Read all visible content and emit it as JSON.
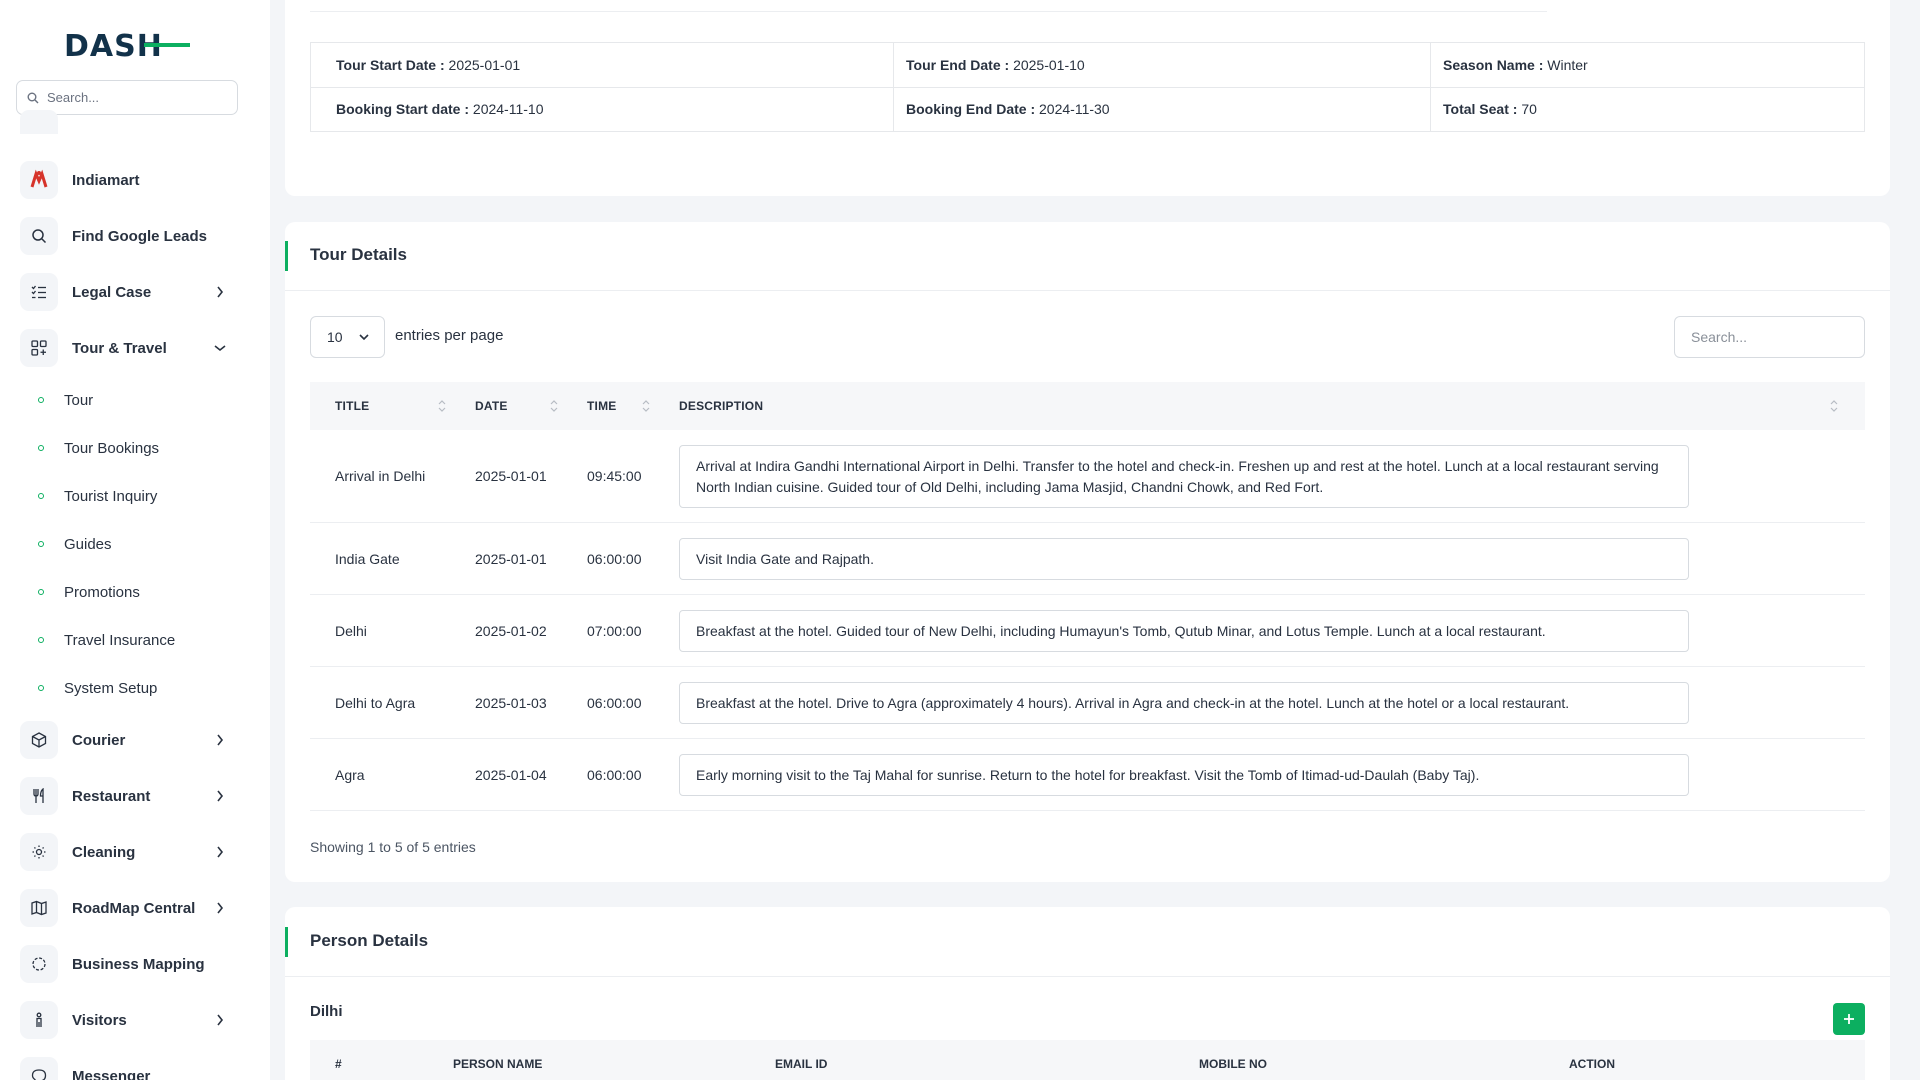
{
  "brand": {
    "logo_text": "DASH",
    "accent_color": "#0caf60"
  },
  "sidebar": {
    "search_placeholder": "Search...",
    "items": [
      {
        "label": "Indiamart",
        "icon": "indiamart-logo-icon",
        "has_chevron": false
      },
      {
        "label": "Find Google Leads",
        "icon": "search-icon",
        "has_chevron": false
      },
      {
        "label": "Legal Case",
        "icon": "list-check-icon",
        "has_chevron": true
      },
      {
        "label": "Tour & Travel",
        "icon": "grid-plus-icon",
        "has_chevron": true,
        "expanded": true
      },
      {
        "label": "Courier",
        "icon": "package-icon",
        "has_chevron": true
      },
      {
        "label": "Restaurant",
        "icon": "fork-knife-icon",
        "has_chevron": true
      },
      {
        "label": "Cleaning",
        "icon": "sun-icon",
        "has_chevron": true
      },
      {
        "label": "RoadMap Central",
        "icon": "map-icon",
        "has_chevron": true
      },
      {
        "label": "Business Mapping",
        "icon": "circle-dashed-icon",
        "has_chevron": false
      },
      {
        "label": "Visitors",
        "icon": "person-icon",
        "has_chevron": true
      },
      {
        "label": "Messenger",
        "icon": "chat-icon",
        "has_chevron": false
      }
    ],
    "sub_items": [
      "Tour",
      "Tour Bookings",
      "Tourist Inquiry",
      "Guides",
      "Promotions",
      "Travel Insurance",
      "System Setup"
    ]
  },
  "tour_info": {
    "tour_start_label": "Tour Start Date :",
    "tour_start_value": "2025-01-01",
    "tour_end_label": "Tour End Date :",
    "tour_end_value": "2025-01-10",
    "season_label": "Season Name :",
    "season_value": "Winter",
    "booking_start_label": "Booking Start date :",
    "booking_start_value": "2024-11-10",
    "booking_end_label": "Booking End Date :",
    "booking_end_value": "2024-11-30",
    "total_seat_label": "Total Seat :",
    "total_seat_value": "70"
  },
  "tour_details": {
    "title": "Tour Details",
    "entries_value": "10",
    "entries_label": "entries per page",
    "search_placeholder": "Search...",
    "columns": [
      "TITLE",
      "DATE",
      "TIME",
      "DESCRIPTION"
    ],
    "rows": [
      {
        "title": "Arrival in Delhi",
        "date": "2025-01-01",
        "time": "09:45:00",
        "description": "Arrival at Indira Gandhi International Airport in Delhi. Transfer to the hotel and check-in. Freshen up and rest at the hotel. Lunch at a local restaurant serving North Indian cuisine. Guided tour of Old Delhi, including Jama Masjid, Chandni Chowk, and Red Fort."
      },
      {
        "title": "India Gate",
        "date": "2025-01-01",
        "time": "06:00:00",
        "description": "Visit India Gate and Rajpath."
      },
      {
        "title": "Delhi",
        "date": "2025-01-02",
        "time": "07:00:00",
        "description": "Breakfast at the hotel. Guided tour of New Delhi, including Humayun's Tomb, Qutub Minar, and Lotus Temple. Lunch at a local restaurant."
      },
      {
        "title": "Delhi to Agra",
        "date": "2025-01-03",
        "time": "06:00:00",
        "description": "Breakfast at the hotel. Drive to Agra (approximately 4 hours). Arrival in Agra and check-in at the hotel. Lunch at the hotel or a local restaurant."
      },
      {
        "title": "Agra",
        "date": "2025-01-04",
        "time": "06:00:00",
        "description": "Early morning visit to the Taj Mahal for sunrise. Return to the hotel for breakfast. Visit the Tomb of Itimad-ud-Daulah (Baby Taj)."
      }
    ],
    "showing_text": "Showing 1 to 5 of 5 entries"
  },
  "person_details": {
    "title": "Person Details",
    "group_name": "Dilhi",
    "add_label": "+",
    "columns": [
      "#",
      "PERSON NAME",
      "EMAIL ID",
      "MOBILE NO",
      "ACTION"
    ]
  }
}
